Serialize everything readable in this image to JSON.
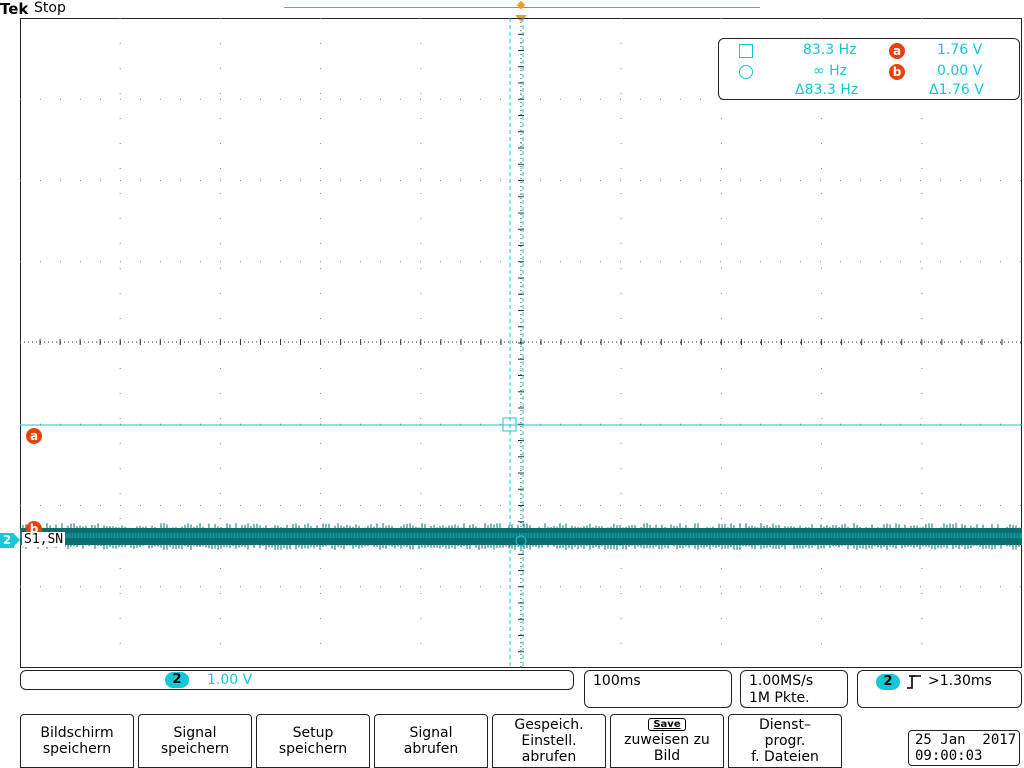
{
  "header": {
    "brand": "Tek",
    "status": "Stop"
  },
  "cursor_readout": {
    "row1": {
      "freq": "83.3 Hz",
      "marker": "a",
      "volt": "1.76 V"
    },
    "row2": {
      "freq": "∞ Hz",
      "marker": "b",
      "volt": "0.00 V"
    },
    "row3": {
      "freq": "Δ83.3 Hz",
      "volt": "Δ1.76 V"
    }
  },
  "markers": {
    "cursor_a": "a",
    "cursor_b": "b",
    "channel": "2",
    "channel_label": "S1,SN"
  },
  "status_bar": {
    "channel": "2",
    "volts_per_div": "1.00 V",
    "timebase": "100ms",
    "sample_rate": "1.00MS/s",
    "record_length": "1M Pkte.",
    "trigger_channel": "2",
    "trigger_level": ">1.30ms"
  },
  "softkeys": [
    {
      "line1": "Bildschirm",
      "line2": "speichern"
    },
    {
      "line1": "Signal",
      "line2": "speichern"
    },
    {
      "line1": "Setup",
      "line2": "speichern"
    },
    {
      "line1": "Signal",
      "line2": "abrufen"
    },
    {
      "line1": "Gespeich.",
      "line2": "Einstell.",
      "line3": "abrufen"
    },
    {
      "badge": "Save",
      "line1": "zuweisen zu",
      "line2": "Bild"
    },
    {
      "line1": "Dienst–",
      "line2": "progr.",
      "line3": "f. Dateien"
    }
  ],
  "datetime": {
    "date": "25 Jan  2017",
    "time": "09:00:03"
  },
  "colors": {
    "trace": "#0a6d70",
    "cursor": "#14c8d6",
    "marker": "#e8420c",
    "trigger": "#f0a020"
  }
}
